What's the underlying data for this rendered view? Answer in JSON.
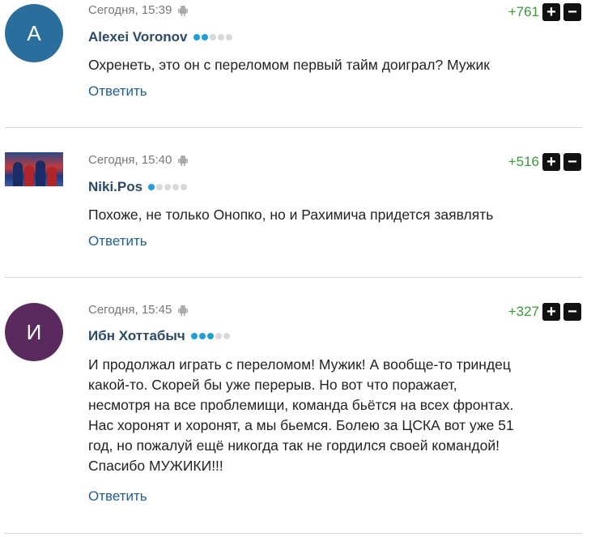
{
  "comments": [
    {
      "avatar_letter": "A",
      "avatar_color": "#2a6e9e",
      "timestamp": "Сегодня, 15:39",
      "author": "Alexei Voronov",
      "rating_level": 2,
      "score": "+761",
      "text": "Охренеть, это он с переломом первый тайм доиграл? Мужик",
      "reply_label": "Ответить"
    },
    {
      "avatar_letter": "",
      "avatar_color": "",
      "timestamp": "Сегодня, 15:40",
      "author": "Niki.Pos",
      "rating_level": 1,
      "score": "+516",
      "text": "Похоже, не только Онопко, но и Рахимича придется заявлять",
      "reply_label": "Ответить"
    },
    {
      "avatar_letter": "И",
      "avatar_color": "#5a2a5e",
      "timestamp": "Сегодня, 15:45",
      "author": "Ибн Хоттабыч",
      "rating_level": 3,
      "score": "+327",
      "text_lines": [
        "И продолжал играть с переломом! Мужик! А вообще-то триндец",
        "какой-то. Скорей бы уже перерыв. Но вот что поражает,",
        "несмотря на все проблемищи, команда бьётся на всех фронтах.",
        "Нас хоронят и хоронят, а мы бьемся. Болею за ЦСКА вот уже 51",
        "год, но пожалуй ещё никогда так не гордился своей командой!",
        "Спасибо МУЖИКИ!!!"
      ],
      "reply_label": "Ответить"
    }
  ],
  "vote_plus_symbol": "+",
  "vote_minus_symbol": "−"
}
